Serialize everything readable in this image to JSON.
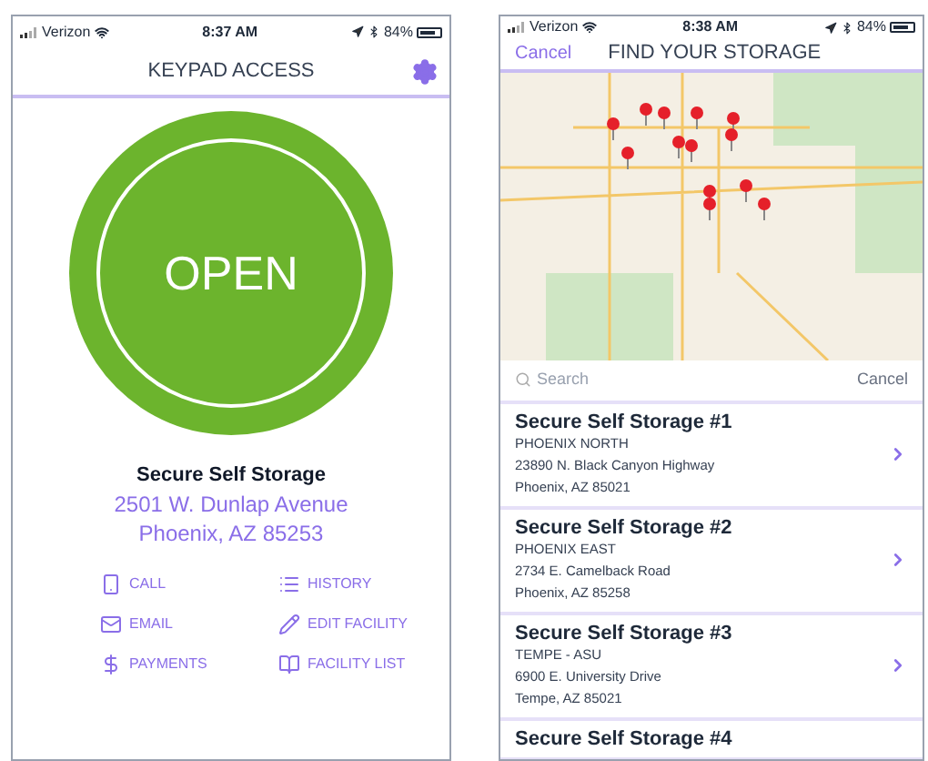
{
  "screens": [
    {
      "status_bar": {
        "carrier": "Verizon",
        "time": "8:37 AM",
        "battery": "84%"
      },
      "nav": {
        "title": "KEYPAD ACCESS"
      },
      "open_button": "OPEN",
      "facility": {
        "name": "Secure Self Storage",
        "address_line_1": "2501 W. Dunlap Avenue",
        "address_line_2": "Phoenix, AZ 85253"
      },
      "actions": [
        {
          "kind": "phone",
          "label": "CALL"
        },
        {
          "kind": "list",
          "label": "HISTORY"
        },
        {
          "kind": "mail",
          "label": "EMAIL"
        },
        {
          "kind": "pencil",
          "label": "EDIT FACILITY"
        },
        {
          "kind": "dollar",
          "label": "PAYMENTS"
        },
        {
          "kind": "book",
          "label": "FACILITY LIST"
        }
      ]
    },
    {
      "status_bar": {
        "carrier": "Verizon",
        "time": "8:38 AM",
        "battery": "84%"
      },
      "nav": {
        "cancel": "Cancel",
        "title": "FIND YOUR STORAGE"
      },
      "search": {
        "placeholder": "Search",
        "cancel": "Cancel"
      },
      "results": [
        {
          "name": "Secure Self Storage #1",
          "area": "PHOENIX NORTH",
          "street": "23890 N. Black Canyon Highway",
          "city": "Phoenix, AZ  85021"
        },
        {
          "name": "Secure Self Storage #2",
          "area": "PHOENIX EAST",
          "street": "2734 E. Camelback Road",
          "city": "Phoenix, AZ  85258"
        },
        {
          "name": "Secure Self Storage #3",
          "area": "TEMPE - ASU",
          "street": "6900 E. University Drive",
          "city": "Tempe, AZ  85021"
        },
        {
          "name": "Secure Self Storage #4"
        }
      ]
    }
  ]
}
